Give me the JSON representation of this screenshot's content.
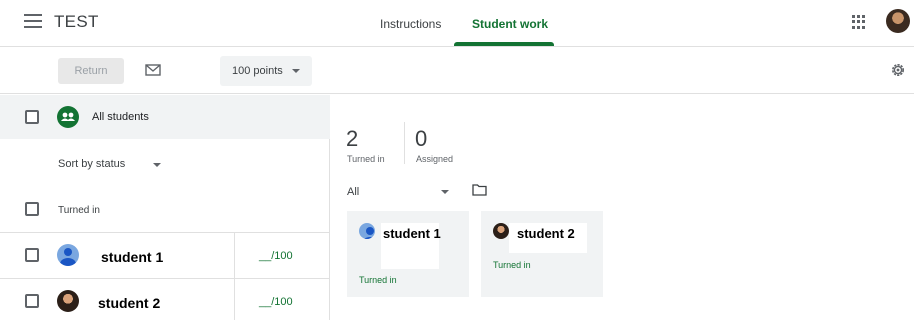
{
  "header": {
    "title": "TEST",
    "tabs": [
      {
        "label": "Instructions"
      },
      {
        "label": "Student work"
      }
    ],
    "active_tab": "Student work"
  },
  "toolbar": {
    "return_label": "Return",
    "points_label": "100 points"
  },
  "left_panel": {
    "all_students_label": "All students",
    "sort_label": "Sort by status",
    "turned_in_header": "Turned in",
    "students": [
      {
        "name": "student 1",
        "grade": "__/100"
      },
      {
        "name": "student 2",
        "grade": "__/100"
      }
    ]
  },
  "summary": {
    "turned_in_count": "2",
    "turned_in_label": "Turned in",
    "assigned_count": "0",
    "assigned_label": "Assigned"
  },
  "filter": {
    "selected": "All"
  },
  "cards": [
    {
      "name": "student 1",
      "status": "Turned in"
    },
    {
      "name": "student 2",
      "status": "Turned in"
    }
  ],
  "colors": {
    "accent": "#137333",
    "panel_bg": "#f1f3f4"
  }
}
